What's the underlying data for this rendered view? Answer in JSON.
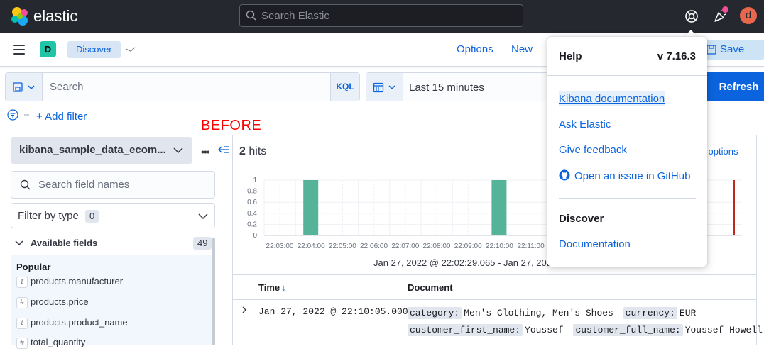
{
  "header": {
    "logo_text": "elastic",
    "search_placeholder": "Search Elastic",
    "user_initial": "d"
  },
  "nav": {
    "space_initial": "D",
    "breadcrumb": "Discover",
    "options_label": "Options",
    "new_label": "New",
    "save_label": "Save"
  },
  "query": {
    "search_placeholder": "Search",
    "language": "KQL",
    "time_range": "Last 15 minutes",
    "refresh_label": "Refresh"
  },
  "filters": {
    "add_filter_label": "+ Add filter"
  },
  "annotation": "BEFORE",
  "sidebar": {
    "index_pattern": "kibana_sample_data_ecom...",
    "field_search_placeholder": "Search field names",
    "filter_by_type_label": "Filter by type",
    "filter_by_type_count": "0",
    "available_fields_label": "Available fields",
    "available_fields_count": "49",
    "popular_label": "Popular",
    "fields": [
      {
        "type": "t",
        "name": "products.manufacturer"
      },
      {
        "type": "#",
        "name": "products.price"
      },
      {
        "type": "t",
        "name": "products.product_name"
      },
      {
        "type": "#",
        "name": "total_quantity"
      }
    ]
  },
  "results": {
    "hits_count": "2",
    "hits_label": "hits",
    "chart_options_label": "rt options",
    "range_text": "Jan 27, 2022 @ 22:02:29.065 - Jan 27, 2022",
    "columns": {
      "time": "Time",
      "document": "Document"
    },
    "rows": [
      {
        "time": "Jan 27, 2022 @ 22:10:05.000",
        "line1": [
          {
            "k": "category:",
            "v": "Men's Clothing, Men's Shoes"
          },
          {
            "k": "currency:",
            "v": "EUR"
          }
        ],
        "line2": [
          {
            "k": "customer_first_name:",
            "v": "Youssef"
          },
          {
            "k": "customer_full_name:",
            "v": "Youssef Howell"
          }
        ]
      }
    ]
  },
  "chart_data": {
    "type": "bar",
    "x_ticks": [
      "22:03:00",
      "22:04:00",
      "22:05:00",
      "22:06:00",
      "22:07:00",
      "22:08:00",
      "22:09:00",
      "22:10:00",
      "22:11:00"
    ],
    "y_ticks": [
      "0",
      "0.2",
      "0.4",
      "0.6",
      "0.8",
      "1"
    ],
    "bars": [
      {
        "x": "22:04:00",
        "value": 1
      },
      {
        "x": "22:10:00",
        "value": 1
      }
    ],
    "ylim": [
      0,
      1
    ],
    "bar_color": "#54b399",
    "now_marker_color": "#bd271e"
  },
  "help_menu": {
    "title": "Help",
    "version": "v 7.16.3",
    "links": [
      "Kibana documentation",
      "Ask Elastic",
      "Give feedback",
      "Open an issue in GitHub"
    ],
    "section_title": "Discover",
    "section_link": "Documentation"
  }
}
